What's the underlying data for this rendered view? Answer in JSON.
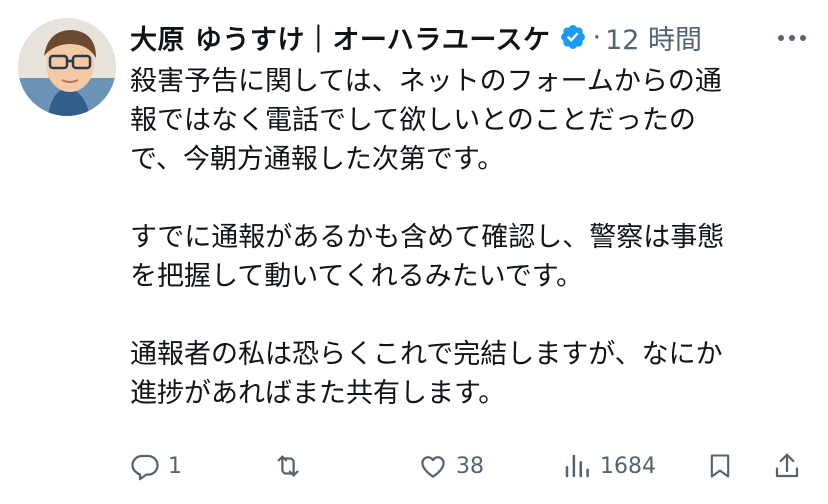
{
  "tweet": {
    "author": {
      "display_name": "大原 ゆうすけ｜オーハラユースケ",
      "verified": true
    },
    "separator": "·",
    "time": "12 時間",
    "paragraphs": [
      [
        "殺害予告に関しては、ネットのフォームからの通",
        "報ではなく電話でして欲しいとのことだったの",
        "で、今朝方通報した次第です。"
      ],
      [
        "すでに通報があるかも含めて確認し、警察は事態",
        "を把握して動いてくれるみたいです。"
      ],
      [
        "通報者の私は恐らくこれで完結しますが、なにか",
        "進捗があればまた共有します。"
      ]
    ],
    "actions": {
      "reply_count": "1",
      "retweet_count": "",
      "like_count": "38",
      "view_count": "1684"
    }
  },
  "colors": {
    "text": "#0f1419",
    "muted": "#536471",
    "verified": "#1d9bf0"
  },
  "icons": [
    "verified-badge-icon",
    "more-icon",
    "reply-icon",
    "retweet-icon",
    "like-icon",
    "views-icon",
    "bookmark-icon",
    "share-icon"
  ]
}
